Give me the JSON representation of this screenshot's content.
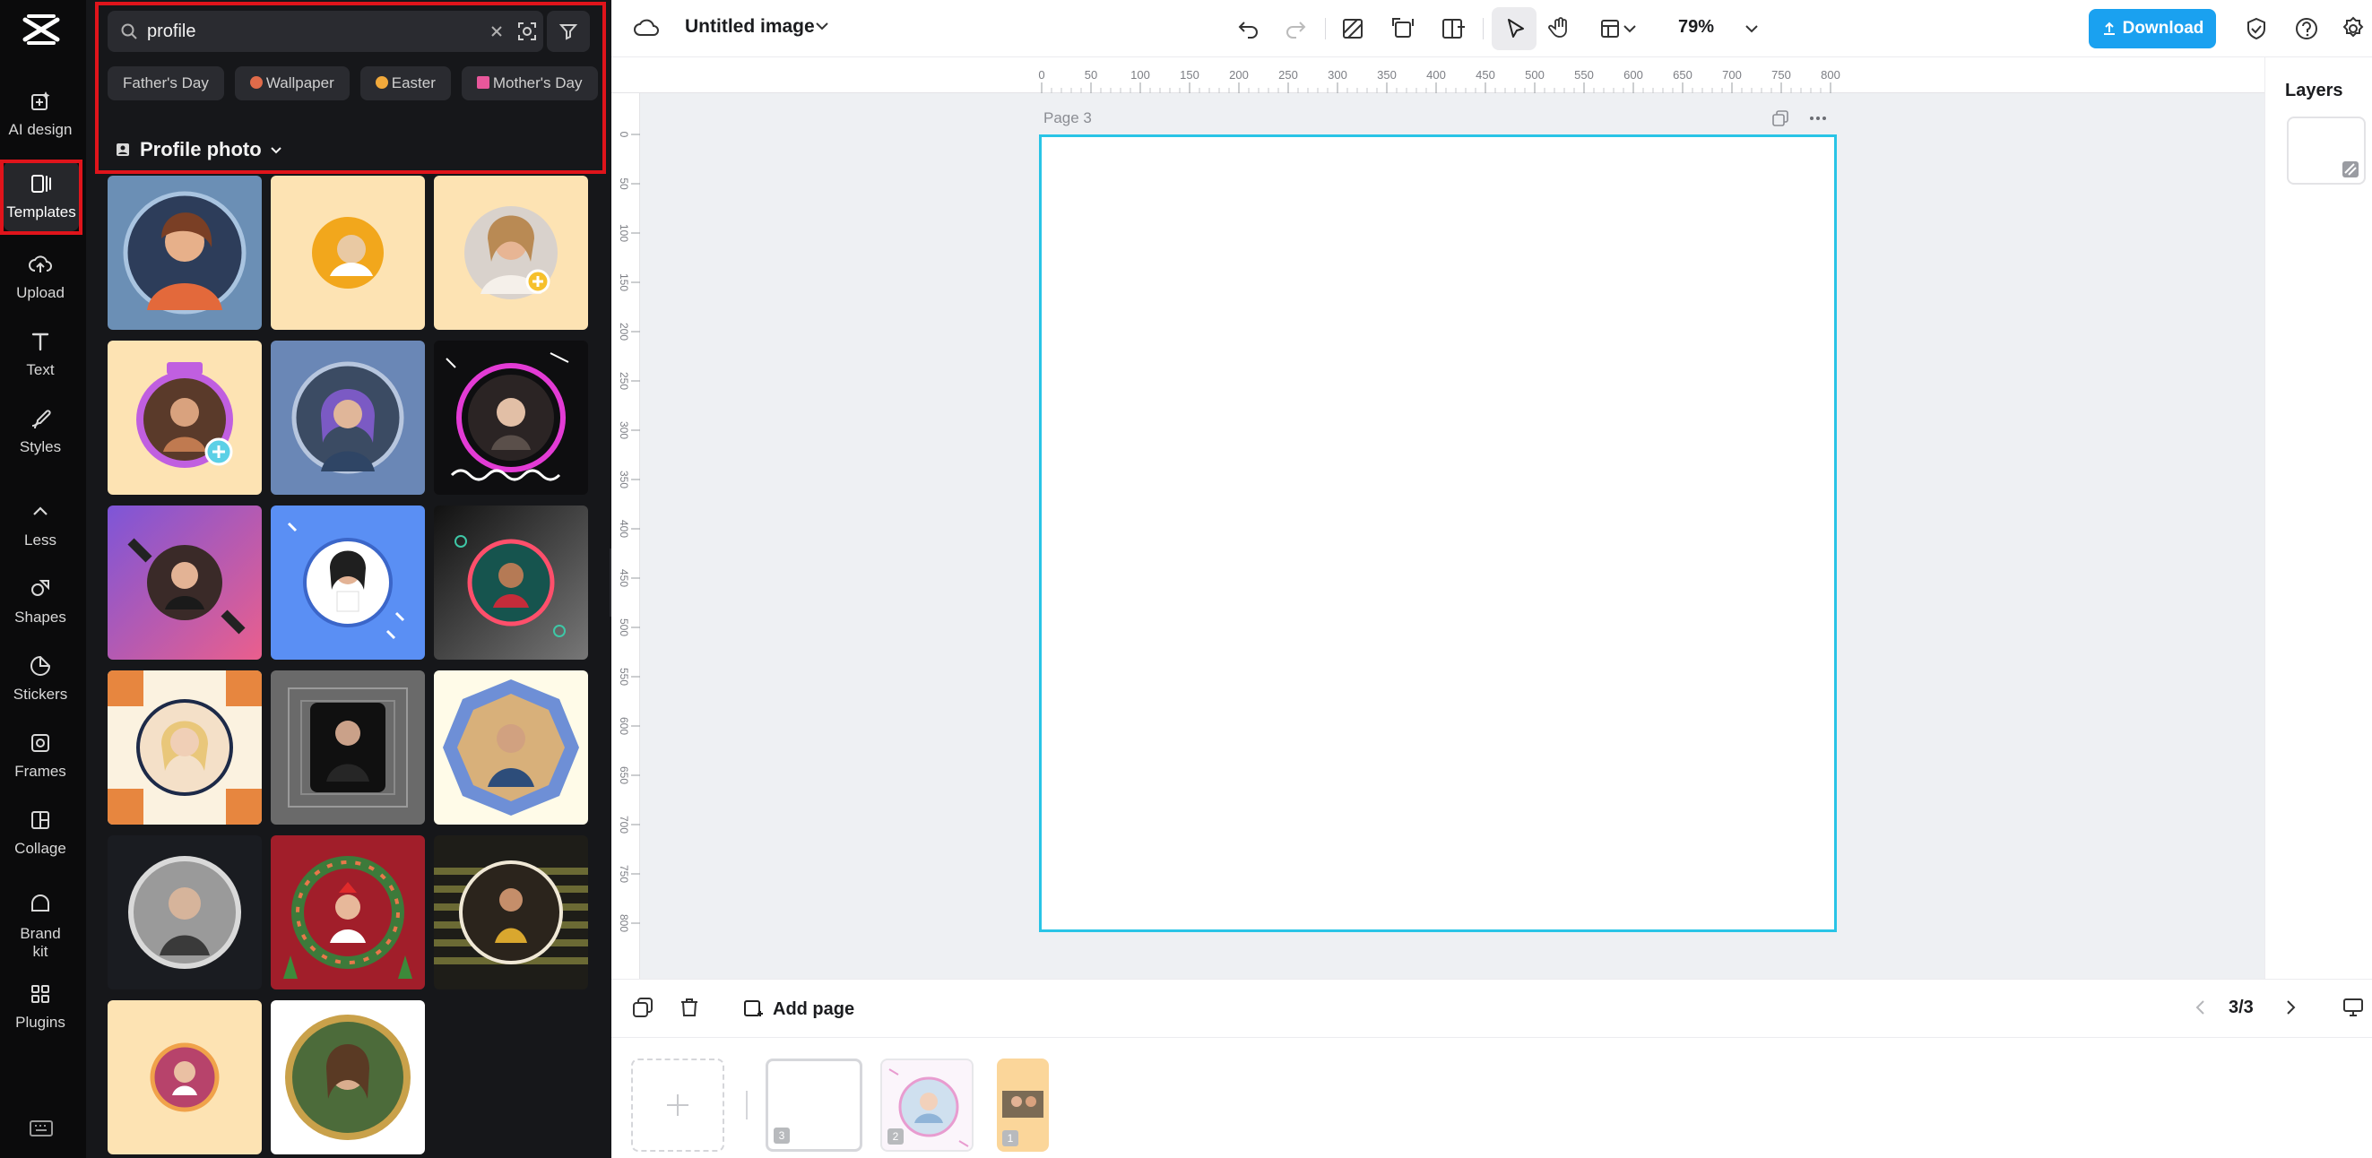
{
  "app": {
    "document_title": "Untitled image",
    "zoom_level": "79%",
    "download_label": "Download"
  },
  "rail": {
    "items": [
      {
        "label": "AI design",
        "icon": "ai-design-icon"
      },
      {
        "label": "Templates",
        "icon": "templates-icon",
        "active": true
      },
      {
        "label": "Upload",
        "icon": "upload-cloud-icon"
      },
      {
        "label": "Text",
        "icon": "text-icon"
      },
      {
        "label": "Styles",
        "icon": "styles-icon"
      },
      {
        "label": "Less",
        "icon": "chevron-up-icon"
      },
      {
        "label": "Shapes",
        "icon": "shapes-icon"
      },
      {
        "label": "Stickers",
        "icon": "stickers-icon"
      },
      {
        "label": "Frames",
        "icon": "frames-icon"
      },
      {
        "label": "Collage",
        "icon": "collage-icon"
      },
      {
        "label": "Brand kit",
        "icon": "brand-kit-icon"
      },
      {
        "label": "Plugins",
        "icon": "plugins-icon"
      }
    ]
  },
  "templates_panel": {
    "search": {
      "value": "profile",
      "placeholder": ""
    },
    "chips": [
      {
        "label": "Father's Day",
        "emoji_color": ""
      },
      {
        "label": "Wallpaper",
        "emoji_color": "#e06b4a"
      },
      {
        "label": "Easter",
        "emoji_color": "#f1a93b"
      },
      {
        "label": "Mother's Day",
        "emoji_color": "#e8579b"
      }
    ],
    "section_title": "Profile photo",
    "template_count": 17
  },
  "canvas": {
    "page_label": "Page 3",
    "ruler_top_ticks": [
      "0",
      "50",
      "100",
      "150",
      "200",
      "250",
      "300",
      "350",
      "400",
      "450",
      "500",
      "550",
      "600",
      "650",
      "700",
      "750",
      "800"
    ],
    "ruler_left_ticks": [
      "0",
      "50",
      "100",
      "150",
      "200",
      "250",
      "300",
      "350",
      "400",
      "450",
      "500",
      "550",
      "600",
      "650",
      "700",
      "750",
      "800"
    ],
    "selection_color": "#29c4e6"
  },
  "layers": {
    "title": "Layers"
  },
  "bottom_bar": {
    "add_page_label": "Add page",
    "pager": "3/3",
    "pages": [
      {
        "number": "3",
        "selected": true
      },
      {
        "number": "2",
        "selected": false
      },
      {
        "number": "1",
        "selected": false
      }
    ]
  },
  "colors": {
    "accent": "#1aa1f0",
    "highlight_box": "#e0141b",
    "rail_bg": "#0b0b0c",
    "panel_bg": "#16171a"
  }
}
